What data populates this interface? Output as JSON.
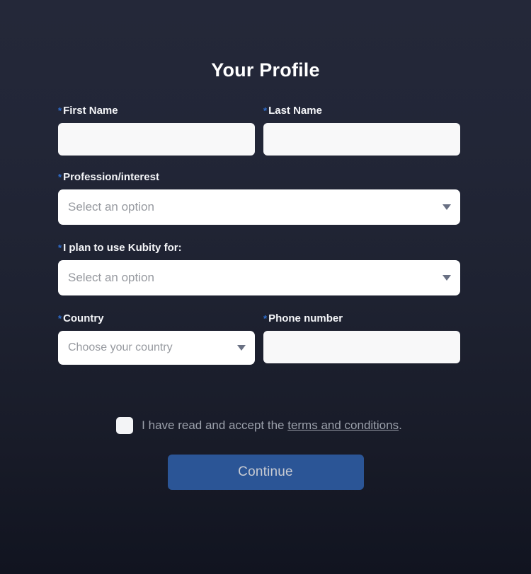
{
  "page": {
    "title": "Your Profile",
    "required_marker": "*",
    "accent_blue": "#2f6fd0",
    "background_top": "#242839",
    "background_bottom": "#111420",
    "button_blue": "#2b5596"
  },
  "form": {
    "first_name": {
      "label": "First Name",
      "value": "",
      "placeholder": "",
      "required": true
    },
    "last_name": {
      "label": "Last Name",
      "value": "",
      "placeholder": "",
      "required": true
    },
    "profession": {
      "label": "Profession/interest",
      "selected": "Select an option",
      "required": true,
      "caret_icon": "chevron-down-icon"
    },
    "plan_to_use": {
      "label": "I plan to use Kubity for:",
      "selected": "Select an option",
      "required": true,
      "caret_icon": "chevron-down-icon"
    },
    "country": {
      "label": "Country",
      "selected": "Choose your country",
      "required": true,
      "caret_icon": "chevron-down-icon"
    },
    "phone": {
      "label": "Phone number",
      "value": "",
      "placeholder": "",
      "required": true
    }
  },
  "terms": {
    "checked": false,
    "text_before": "I have read and accept the ",
    "link_text": "terms and conditions",
    "text_after": "."
  },
  "actions": {
    "continue_label": "Continue"
  }
}
